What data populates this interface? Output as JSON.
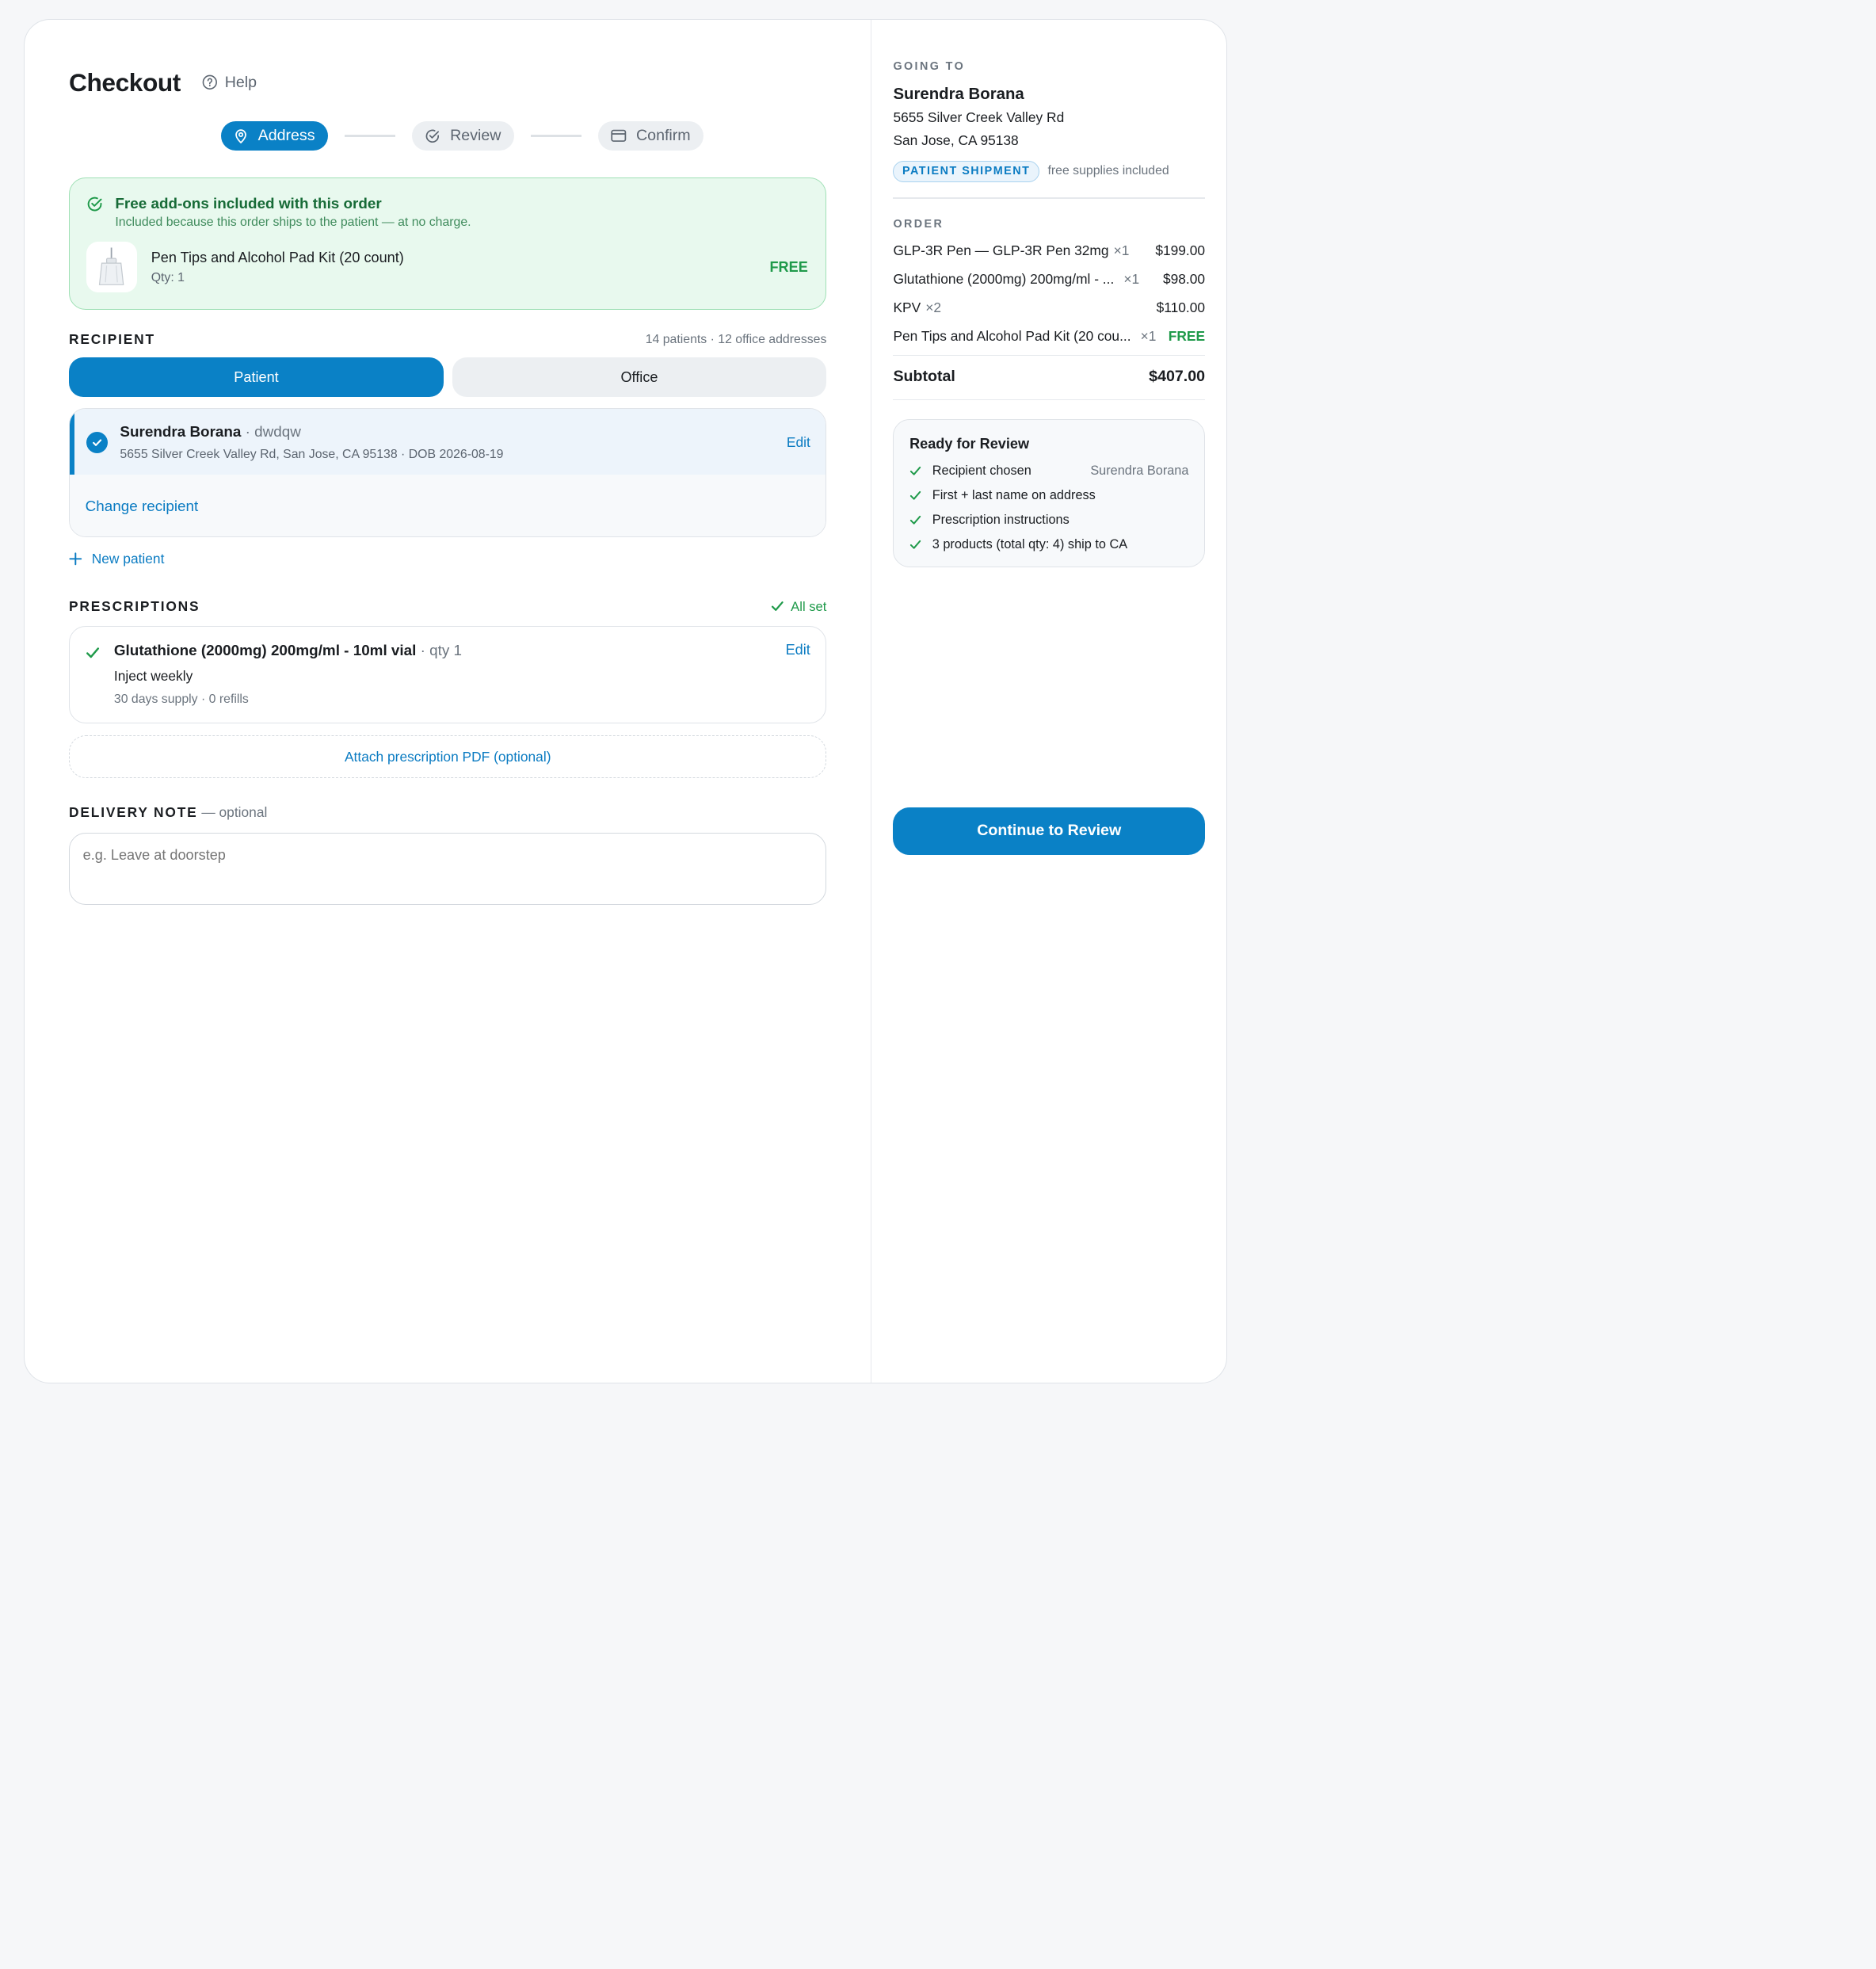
{
  "header": {
    "title": "Checkout",
    "help_label": "Help"
  },
  "stepper": {
    "steps": [
      {
        "label": "Address",
        "icon": "location-pin-icon",
        "active": true
      },
      {
        "label": "Review",
        "icon": "check-circle-icon",
        "active": false
      },
      {
        "label": "Confirm",
        "icon": "card-icon",
        "active": false
      }
    ]
  },
  "addon_banner": {
    "title": "Free add-ons included with this order",
    "subtitle": "Included because this order ships to the patient — at no charge.",
    "item_name": "Pen Tips and Alcohol Pad Kit (20 count)",
    "item_qty": "Qty: 1",
    "price": "FREE"
  },
  "recipient": {
    "label": "RECIPIENT",
    "counts": "14 patients · 12 office addresses",
    "tabs": [
      "Patient",
      "Office"
    ],
    "selected": {
      "name": "Surendra Borana",
      "code": " · dwdqw",
      "details": "5655 Silver Creek Valley Rd, San Jose, CA 95138 · DOB 2026-08-19",
      "edit": "Edit"
    },
    "change": "Change recipient",
    "new_patient": "New patient"
  },
  "prescriptions": {
    "label": "PRESCRIPTIONS",
    "status": "All set",
    "item": {
      "title": "Glutathione (2000mg) 200mg/ml - 10ml vial",
      "qty": " · qty 1",
      "instructions": "Inject weekly",
      "supply": "30 days supply · 0 refills",
      "edit": "Edit"
    },
    "attach": "Attach prescription PDF (optional)"
  },
  "delivery_note": {
    "label": "DELIVERY NOTE",
    "optional": " — optional",
    "placeholder": "e.g. Leave at doorstep"
  },
  "summary": {
    "going_to_label": "GOING TO",
    "name": "Surendra Borana",
    "address_line1": "5655 Silver Creek Valley Rd",
    "address_line2": "San Jose, CA 95138",
    "badge": "PATIENT SHIPMENT",
    "badge_note": "free supplies included",
    "order_label": "ORDER",
    "items": [
      {
        "name": "GLP-3R Pen — GLP-3R Pen 32mg",
        "qty": "×1",
        "price": "$199.00"
      },
      {
        "name": "Glutathione (2000mg) 200mg/ml - ...",
        "qty": "×1",
        "price": "$98.00"
      },
      {
        "name": "KPV",
        "qty": "×2",
        "price": "$110.00"
      },
      {
        "name": "Pen Tips and Alcohol Pad Kit (20 cou...",
        "qty": "×1",
        "price": "FREE"
      }
    ],
    "subtotal_label": "Subtotal",
    "subtotal_value": "$407.00",
    "ready": {
      "title": "Ready for Review",
      "checks": [
        {
          "label": "Recipient chosen",
          "value": "Surendra Borana"
        },
        {
          "label": "First + last name on address",
          "value": ""
        },
        {
          "label": "Prescription instructions",
          "value": ""
        },
        {
          "label": "3 products (total qty: 4) ship to CA",
          "value": ""
        }
      ]
    },
    "cta": "Continue to Review"
  },
  "colors": {
    "accent": "#0a81c6",
    "success": "#1f9a4a",
    "success_bg": "#e8f9ee"
  }
}
